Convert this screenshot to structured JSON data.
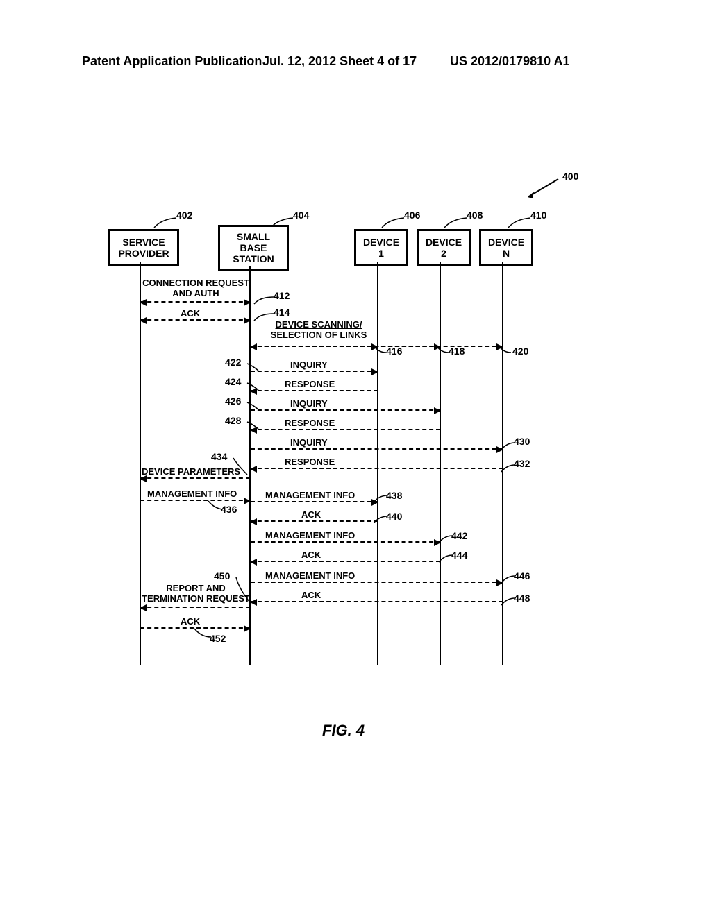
{
  "header": {
    "left": "Patent Application Publication",
    "center": "Jul. 12, 2012  Sheet 4 of 17",
    "right": "US 2012/0179810 A1"
  },
  "figure_label": "FIG. 4",
  "actors": {
    "service_provider": "SERVICE\nPROVIDER",
    "small_base_station": "SMALL\nBASE\nSTATION",
    "device1": "DEVICE\n1",
    "device2": "DEVICE\n2",
    "deviceN": "DEVICE\nN"
  },
  "messages": {
    "conn_req": "CONNECTION REQUEST\nAND AUTH",
    "ack": "ACK",
    "scan": "DEVICE SCANNING/\nSELECTION OF LINKS",
    "inquiry": "INQUIRY",
    "response": "RESPONSE",
    "dev_params": "DEVICE PARAMETERS",
    "mgmt_info": "MANAGEMENT INFO",
    "report_term": "REPORT AND\nTERMINATION REQUEST"
  },
  "refs": {
    "r400": "400",
    "r402": "402",
    "r404": "404",
    "r406": "406",
    "r408": "408",
    "r410": "410",
    "r412": "412",
    "r414": "414",
    "r416": "416",
    "r418": "418",
    "r420": "420",
    "r422": "422",
    "r424": "424",
    "r426": "426",
    "r428": "428",
    "r430": "430",
    "r432": "432",
    "r434": "434",
    "r436": "436",
    "r438": "438",
    "r440": "440",
    "r442": "442",
    "r444": "444",
    "r446": "446",
    "r448": "448",
    "r450": "450",
    "r452": "452"
  }
}
